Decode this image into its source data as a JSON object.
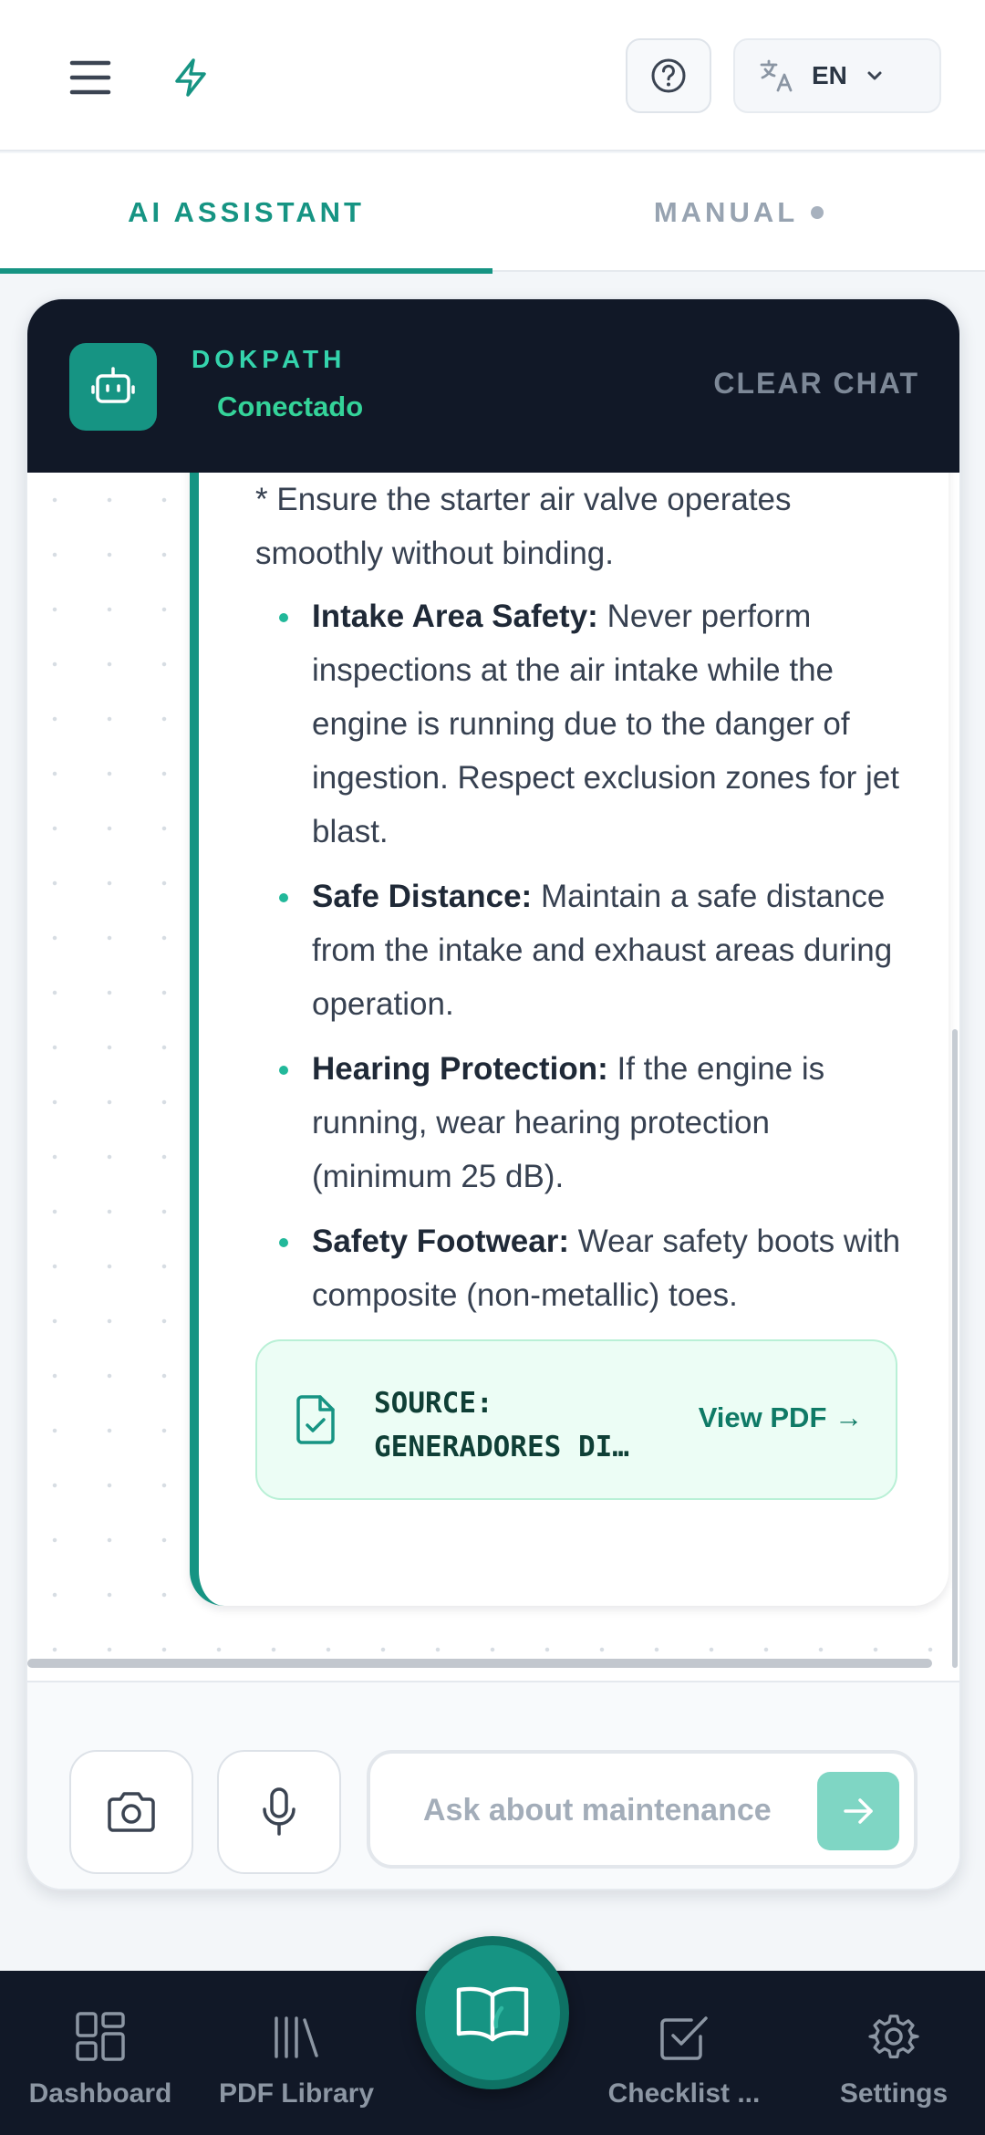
{
  "topbar": {
    "menu_icon": "hamburger-menu-icon",
    "bolt_icon": "lightning-bolt-icon",
    "help_icon": "question-circle-icon",
    "language": {
      "icon": "translate-icon",
      "code": "EN",
      "chevron": "chevron-down-icon"
    }
  },
  "tabs": [
    {
      "label": "AI ASSISTANT",
      "active": true
    },
    {
      "label": "MANUAL",
      "active": false,
      "has_dot": true
    }
  ],
  "chat": {
    "header": {
      "bot_name": "DOKPATH",
      "status": "Conectado",
      "clear_label": "CLEAR CHAT",
      "avatar_icon": "robot-icon"
    },
    "message": {
      "intro": "* Ensure the starter air valve operates smoothly without binding.",
      "items": [
        {
          "title": "Intake Area Safety:",
          "text": " Never perform inspections at the air intake while the engine is running due to the danger of ingestion. Respect exclusion zones for jet blast."
        },
        {
          "title": "Safe Distance:",
          "text": " Maintain a safe distance from the intake and exhaust areas during operation."
        },
        {
          "title": "Hearing Protection:",
          "text": " If the engine is running, wear hearing protection (minimum 25 dB)."
        },
        {
          "title": "Safety Footwear:",
          "text": " Wear safety boots with composite (non-metallic) toes."
        }
      ],
      "source": {
        "label": "SOURCE:",
        "document": "GENERADORES DI…",
        "link_label": "View PDF →",
        "icon": "document-check-icon"
      }
    },
    "composer": {
      "placeholder": "Ask about maintenance",
      "value": "",
      "camera_icon": "camera-icon",
      "mic_icon": "microphone-icon",
      "send_icon": "arrow-right-icon"
    }
  },
  "bottom_nav": {
    "items": [
      {
        "label": "Dashboard",
        "icon": "dashboard-grid-icon"
      },
      {
        "label": "PDF Library",
        "icon": "library-icon"
      },
      {
        "label": "Checklist ...",
        "icon": "checkbox-icon"
      },
      {
        "label": "Settings",
        "icon": "gear-icon"
      }
    ],
    "center_icon": "open-book-icon"
  },
  "colors": {
    "accent": "#169483",
    "dark": "#111827",
    "status_green": "#34d399",
    "source_bg": "#ecfdf5"
  }
}
